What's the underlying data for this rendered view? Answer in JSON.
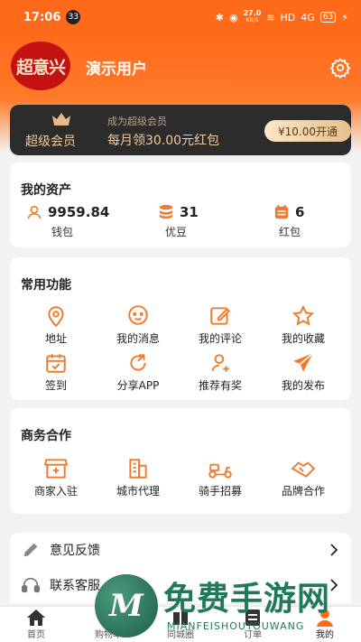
{
  "status_bar": {
    "time": "17:06",
    "notif_count": "33",
    "net_speed": "27.0",
    "net_unit": "KB/S",
    "hd": "HD",
    "signal": "4G",
    "battery": "63"
  },
  "profile": {
    "logo_text": "超意兴",
    "username": "演示用户"
  },
  "vip": {
    "label": "超级会员",
    "subtitle": "成为超级会员",
    "promo": "每月领30.00元红包",
    "button": "¥10.00开通"
  },
  "assets": {
    "title": "我的资产",
    "items": [
      {
        "value": "9959.84",
        "label": "钱包",
        "icon": "user-icon"
      },
      {
        "value": "31",
        "label": "优豆",
        "icon": "coins-icon"
      },
      {
        "value": "6",
        "label": "红包",
        "icon": "coupon-icon"
      }
    ]
  },
  "functions": {
    "title": "常用功能",
    "items": [
      {
        "label": "地址",
        "icon": "location-icon"
      },
      {
        "label": "我的消息",
        "icon": "message-icon"
      },
      {
        "label": "我的评论",
        "icon": "edit-icon"
      },
      {
        "label": "我的收藏",
        "icon": "star-icon"
      },
      {
        "label": "签到",
        "icon": "calendar-icon"
      },
      {
        "label": "分享APP",
        "icon": "share-icon"
      },
      {
        "label": "推荐有奖",
        "icon": "recommend-icon"
      },
      {
        "label": "我的发布",
        "icon": "send-icon"
      }
    ]
  },
  "business": {
    "title": "商务合作",
    "items": [
      {
        "label": "商家入驻",
        "icon": "store-icon"
      },
      {
        "label": "城市代理",
        "icon": "building-icon"
      },
      {
        "label": "骑手招募",
        "icon": "scooter-icon"
      },
      {
        "label": "品牌合作",
        "icon": "handshake-icon"
      }
    ]
  },
  "list": [
    {
      "label": "意见反馈",
      "icon": "pencil-icon"
    },
    {
      "label": "联系客服",
      "icon": "headset-icon"
    }
  ],
  "tabs": [
    {
      "label": "首页",
      "icon": "home-icon"
    },
    {
      "label": "购物车",
      "icon": "cart-icon"
    },
    {
      "label": "同城圈",
      "icon": "circle-icon"
    },
    {
      "label": "订单",
      "icon": "order-icon"
    },
    {
      "label": "我的",
      "icon": "profile-icon"
    }
  ],
  "watermark": {
    "logo": "M",
    "title": "免费手游网",
    "subtitle": "MIANFEISHOUYOUWANG"
  },
  "colors": {
    "accent": "#ff6a1a",
    "icon": "#f07a2e",
    "vip_dark": "#2c2c2c",
    "vip_gold": "#f0c89a",
    "watermark": "#1e7a57"
  }
}
